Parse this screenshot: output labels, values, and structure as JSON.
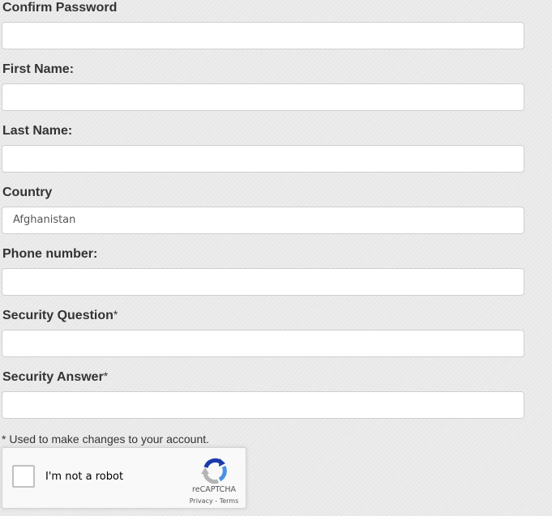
{
  "form": {
    "confirm_password": {
      "label": "Confirm Password",
      "value": ""
    },
    "first_name": {
      "label": "First Name:",
      "value": ""
    },
    "last_name": {
      "label": "Last Name:",
      "value": ""
    },
    "country": {
      "label": "Country",
      "selected": "Afghanistan"
    },
    "phone_number": {
      "label": "Phone number:",
      "value": ""
    },
    "security_question": {
      "label": "Security Question",
      "required_mark": "*",
      "value": ""
    },
    "security_answer": {
      "label": "Security Answer",
      "required_mark": "*",
      "value": ""
    },
    "footnote": "* Used to make changes to your account."
  },
  "recaptcha": {
    "checkbox_label": "I'm not a robot",
    "brand": "reCAPTCHA",
    "privacy_link": "Privacy",
    "separator": " - ",
    "terms_link": "Terms",
    "logo_icon": "recaptcha-logo-icon",
    "colors": {
      "logo_blue": "#1c3aa9",
      "logo_light_blue": "#4a90e2",
      "logo_gray": "#b4b4b4"
    }
  }
}
